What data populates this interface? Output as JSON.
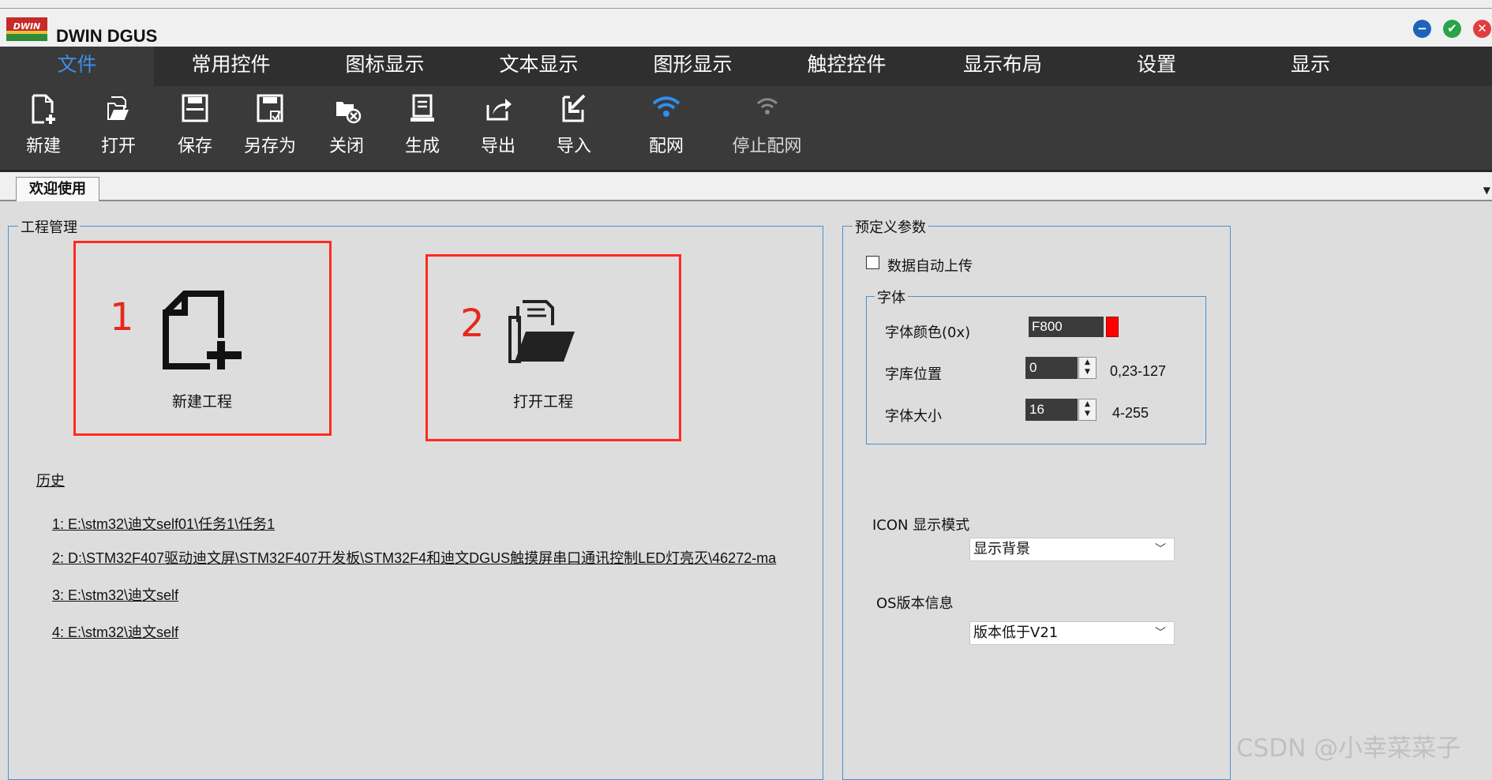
{
  "window": {
    "title": "DWIN DGUS",
    "logo_text": "DWIN",
    "buttons": {
      "minimize": "−",
      "maximize": "✔",
      "close": "✕"
    }
  },
  "menu": {
    "items": [
      {
        "label": "文件",
        "active": true
      },
      {
        "label": "常用控件"
      },
      {
        "label": "图标显示"
      },
      {
        "label": "文本显示"
      },
      {
        "label": "图形显示"
      },
      {
        "label": "触控控件"
      },
      {
        "label": "显示布局"
      },
      {
        "label": "设置"
      },
      {
        "label": "显示"
      }
    ]
  },
  "toolbar": {
    "items": [
      {
        "label": "新建",
        "icon": "new-file-icon"
      },
      {
        "label": "打开",
        "icon": "open-folder-icon"
      },
      {
        "label": "保存",
        "icon": "save-icon"
      },
      {
        "label": "另存为",
        "icon": "save-as-icon"
      },
      {
        "label": "关闭",
        "icon": "close-file-icon"
      },
      {
        "label": "生成",
        "icon": "generate-icon"
      },
      {
        "label": "导出",
        "icon": "export-icon"
      },
      {
        "label": "导入",
        "icon": "import-icon"
      },
      {
        "label": "配网",
        "icon": "wifi-icon"
      },
      {
        "label": "停止配网",
        "icon": "wifi-off-icon"
      }
    ]
  },
  "tabs": {
    "welcome": "欢迎使用"
  },
  "project": {
    "group_title": "工程管理",
    "new_number": "1",
    "new_label": "新建工程",
    "open_number": "2",
    "open_label": "打开工程",
    "history_title": "历史",
    "history": [
      "1: E:\\stm32\\迪文self01\\任务1\\任务1",
      "2: D:\\STM32F407驱动迪文屏\\STM32F407开发板\\STM32F4和迪文DGUS触摸屏串口通讯控制LED灯亮灭\\46272-ma",
      "3: E:\\stm32\\迪文self",
      "4: E:\\stm32\\迪文self"
    ]
  },
  "params": {
    "group_title": "预定义参数",
    "auto_upload_label": "数据自动上传",
    "auto_upload_checked": false,
    "font_group_title": "字体",
    "font_color_label": "字体颜色(0x)",
    "font_color_value": "F800",
    "font_color_swatch": "#ff0000",
    "font_lib_label": "字库位置",
    "font_lib_value": "0",
    "font_lib_range": "0,23-127",
    "font_size_label": "字体大小",
    "font_size_value": "16",
    "font_size_range": "4-255",
    "icon_mode_label": "ICON 显示模式",
    "icon_mode_value": "显示背景",
    "os_label": "OS版本信息",
    "os_value": "版本低于V21"
  },
  "watermark": "CSDN @小幸菜菜子"
}
